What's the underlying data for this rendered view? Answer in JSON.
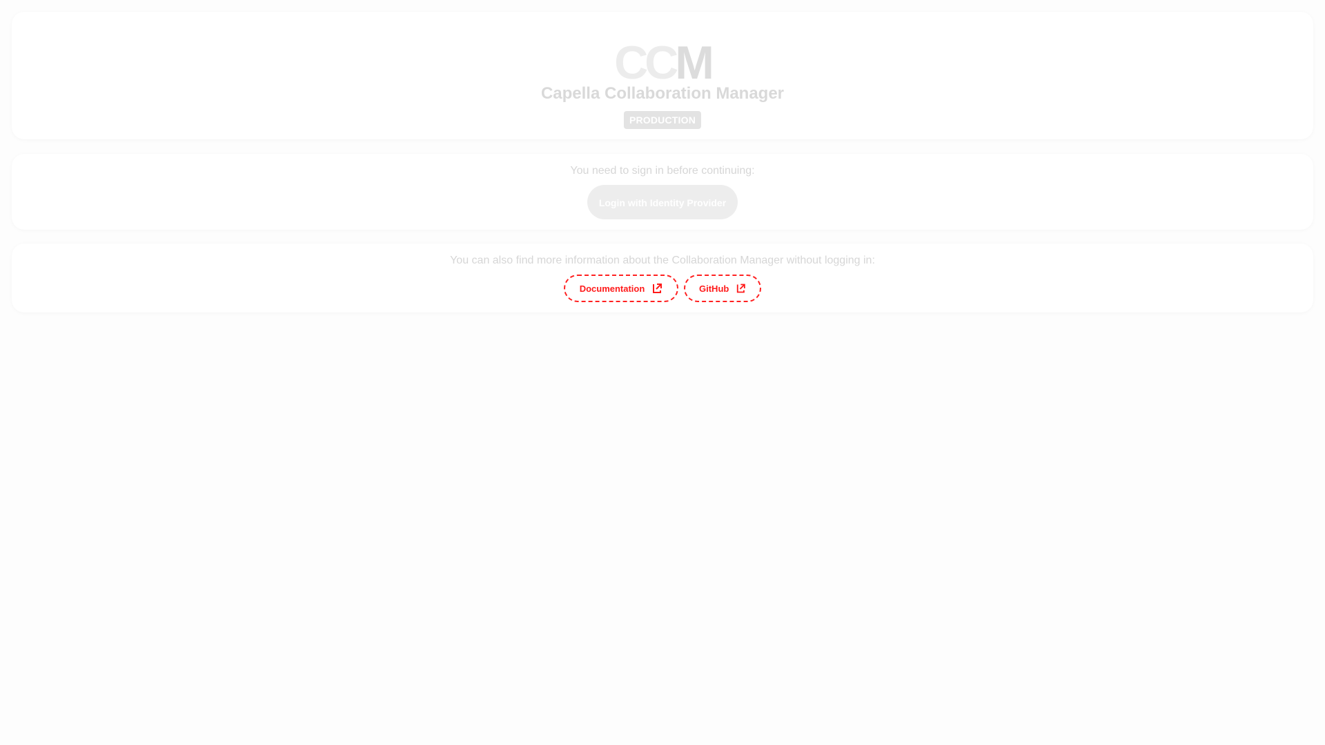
{
  "header": {
    "logo_cc": "CC",
    "logo_m": "M",
    "title": "Capella Collaboration Manager",
    "environment_badge": "PRODUCTION"
  },
  "login": {
    "prompt": "You need to sign in before continuing:",
    "button_label": "Login with Identity Provider"
  },
  "info": {
    "text": "You can also find more information about the Collaboration Manager without logging in:",
    "links": [
      {
        "label": "Documentation",
        "icon": "open-in-new-icon"
      },
      {
        "label": "GitHub",
        "icon": "open-in-new-icon"
      }
    ]
  },
  "colors": {
    "background": "#fdfdfd",
    "card": "#ffffff",
    "link_outline": "#ff2020"
  }
}
